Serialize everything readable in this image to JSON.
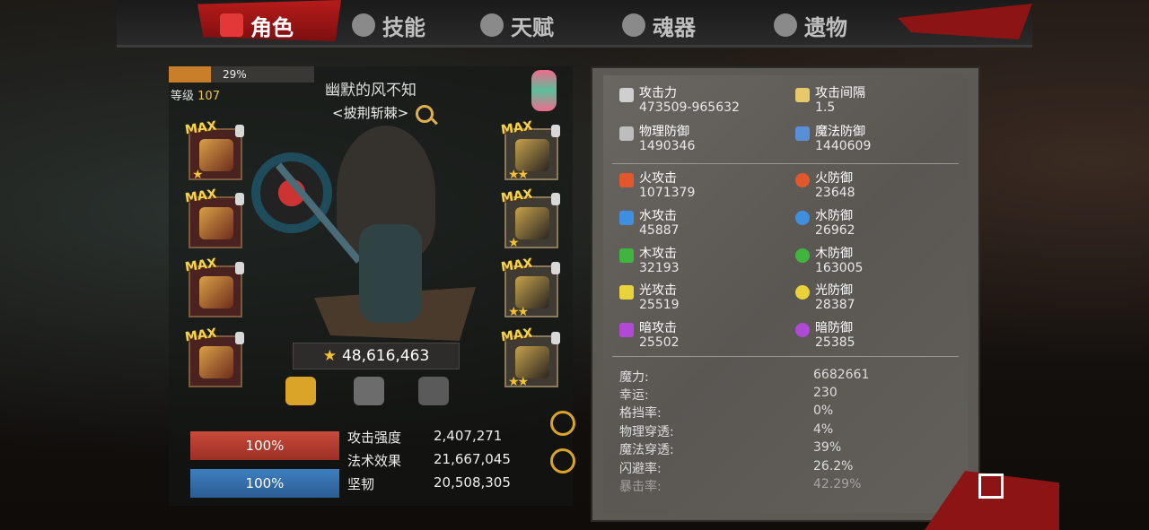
{
  "tabs": [
    {
      "label": "角色",
      "active": true,
      "icon": "character-icon"
    },
    {
      "label": "技能",
      "active": false,
      "icon": "skill-icon"
    },
    {
      "label": "天赋",
      "active": false,
      "icon": "talent-icon"
    },
    {
      "label": "魂器",
      "active": false,
      "icon": "soul-icon"
    },
    {
      "label": "遗物",
      "active": false,
      "icon": "relic-icon"
    }
  ],
  "level": {
    "progress_label": "29%",
    "progress": 0.29,
    "label": "等级",
    "value": "107"
  },
  "character": {
    "name": "幽默的风不知",
    "title": "<披荆斩棘>"
  },
  "power": {
    "value": "48,616,463"
  },
  "equipment_left": [
    {
      "badge": "MAX",
      "stars": "★"
    },
    {
      "badge": "MAX",
      "stars": ""
    },
    {
      "badge": "MAX",
      "stars": ""
    },
    {
      "badge": "MAX",
      "stars": ""
    }
  ],
  "equipment_right": [
    {
      "badge": "MAX",
      "stars": "★★"
    },
    {
      "badge": "MAX",
      "stars": "★"
    },
    {
      "badge": "MAX",
      "stars": "★★"
    },
    {
      "badge": "MAX",
      "stars": "★★"
    }
  ],
  "bars": {
    "hp": "100%",
    "mp": "100%"
  },
  "main_stats": [
    {
      "label": "攻击强度",
      "value": "2,407,271"
    },
    {
      "label": "法术效果",
      "value": "21,667,045"
    },
    {
      "label": "坚韧",
      "value": "20,508,305"
    }
  ],
  "combat_stats": {
    "attack": {
      "label": "攻击力",
      "value": "473509-965632"
    },
    "attack_interval": {
      "label": "攻击间隔",
      "value": "1.5"
    },
    "phys_def": {
      "label": "物理防御",
      "value": "1490346"
    },
    "magic_def": {
      "label": "魔法防御",
      "value": "1440609"
    }
  },
  "elements": [
    {
      "atk_label": "火攻击",
      "atk": "1071379",
      "def_label": "火防御",
      "def": "23648",
      "color": "#e2572b"
    },
    {
      "atk_label": "水攻击",
      "atk": "45887",
      "def_label": "水防御",
      "def": "26962",
      "color": "#3f8fe0"
    },
    {
      "atk_label": "木攻击",
      "atk": "32193",
      "def_label": "木防御",
      "def": "163005",
      "color": "#3fb43f"
    },
    {
      "atk_label": "光攻击",
      "atk": "25519",
      "def_label": "光防御",
      "def": "28387",
      "color": "#e8d43a"
    },
    {
      "atk_label": "暗攻击",
      "atk": "25502",
      "def_label": "暗防御",
      "def": "25385",
      "color": "#b04ad6"
    }
  ],
  "misc": [
    {
      "label": "魔力:",
      "value": "6682661"
    },
    {
      "label": "幸运:",
      "value": "230"
    },
    {
      "label": "格挡率:",
      "value": "0%"
    },
    {
      "label": "物理穿透:",
      "value": "4%"
    },
    {
      "label": "魔法穿透:",
      "value": "39%"
    },
    {
      "label": "闪避率:",
      "value": "26.2%"
    },
    {
      "label": "暴击率:",
      "value": "42.29%"
    }
  ]
}
